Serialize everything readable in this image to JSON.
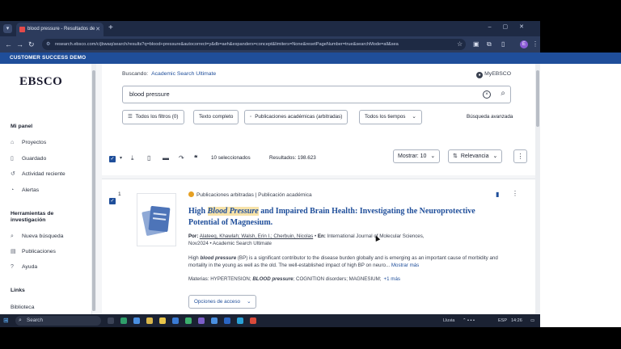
{
  "browser": {
    "tab_title": "blood pressure - Resultados de",
    "url": "research.ebsco.com/c/jbwaq/search/results?q=blood+pressure&autocorrect=y&db=aeh&expanders=concept&limiters=None&resetPageNumber=true&searchMode=all&sea"
  },
  "banner": {
    "text": "CUSTOMER SUCCESS DEMO"
  },
  "sidebar": {
    "logo": "EBSCO",
    "panel_title": "Mi panel",
    "panel_items": [
      {
        "label": "Proyectos",
        "icon": "project-icon"
      },
      {
        "label": "Guardado",
        "icon": "bookmark-icon"
      },
      {
        "label": "Actividad reciente",
        "icon": "history-icon"
      },
      {
        "label": "Alertas",
        "icon": "bell-icon"
      }
    ],
    "tools_title": "Herramientas de investigación",
    "tools_items": [
      {
        "label": "Nueva búsqueda",
        "icon": "search-icon"
      },
      {
        "label": "Publicaciones",
        "icon": "publications-icon"
      },
      {
        "label": "Ayuda",
        "icon": "help-icon"
      }
    ],
    "links_title": "Links",
    "links_items": [
      {
        "label": "Biblioteca"
      }
    ]
  },
  "search": {
    "buscando_label": "Buscando:",
    "database": "Academic Search Ultimate",
    "myebsco": "MyEBSCO",
    "query": "blood pressure",
    "filters": {
      "all_filters": "Todos los filtros (0)",
      "full_text": "Texto completo",
      "peer_reviewed": "Publicaciones académicas (arbitradas)",
      "all_times": "Todos los tiempos"
    },
    "advanced": "Búsqueda avanzada"
  },
  "results_toolbar": {
    "selected": "10 seleccionados",
    "results_count": "Resultados: 198.623",
    "show": "Mostrar: 10",
    "sort": "Relevancia"
  },
  "result1": {
    "number": "1",
    "meta": "Publicaciones arbitradas | Publicación académica",
    "title_pre": "High ",
    "title_hl": "Blood Pressure",
    "title_post": " and Impaired Brain Health: Investigating the Neuroprotective Potential of Magnesium.",
    "by_label": "Por:",
    "authors": "Alateeq, Khawlah; Walsh, Erin I.; Cherbuin, Nicolas",
    "in_label": "En:",
    "journal": "International Journal of Molecular Sciences,",
    "date_db": "Nov2024 • Academic Search Ultimate",
    "abstract_pre": "High ",
    "abstract_bold": "blood pressure",
    "abstract_post": " (BP) is a significant contributor to the disease burden globally and is emerging as an important cause of morbidity and mortality in the young as well as the old. The well-established impact of high BP on neuro...",
    "more_link": "Mostrar más",
    "subjects_label": "Materias:",
    "subjects_pre": "HYPERTENSION; ",
    "subjects_bold": "BLOOD pressure",
    "subjects_post": "; COGNITION disorders; MAGNESIUM;",
    "subjects_more": "+1 más",
    "access_button": "Opciones de acceso"
  },
  "taskbar": {
    "search": "Search",
    "weather": "Lluvia",
    "lang": "ESP",
    "time": "14:26"
  }
}
